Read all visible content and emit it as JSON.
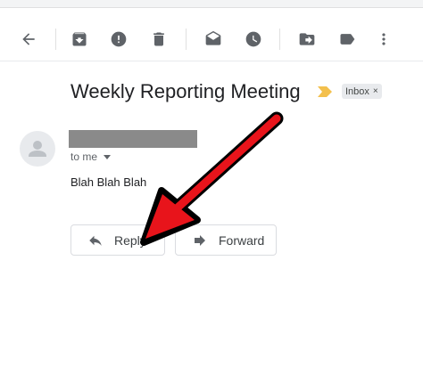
{
  "toolbar": {
    "buttons": [
      {
        "name": "back",
        "icon": "arrow-left-icon"
      },
      {
        "name": "archive",
        "icon": "archive-icon"
      },
      {
        "name": "report-spam",
        "icon": "report-icon"
      },
      {
        "name": "delete",
        "icon": "trash-icon"
      },
      {
        "name": "mark-unread",
        "icon": "mail-open-icon"
      },
      {
        "name": "snooze",
        "icon": "clock-icon"
      },
      {
        "name": "move-to",
        "icon": "move-folder-icon"
      },
      {
        "name": "labels",
        "icon": "label-icon"
      },
      {
        "name": "more",
        "icon": "more-vert-icon"
      }
    ]
  },
  "email": {
    "subject": "Weekly Reporting Meeting",
    "label_chip": "Inbox",
    "label_chip_close": "×",
    "recipient": "to me",
    "body": "Blah Blah Blah"
  },
  "actions": {
    "reply_label": "Reply",
    "forward_label": "Forward"
  },
  "colors": {
    "icon_gray": "#5f6368",
    "importance_marker": "#f3c04d",
    "annotation_arrow": "#e8141b",
    "redaction": "#8a8a8a"
  }
}
